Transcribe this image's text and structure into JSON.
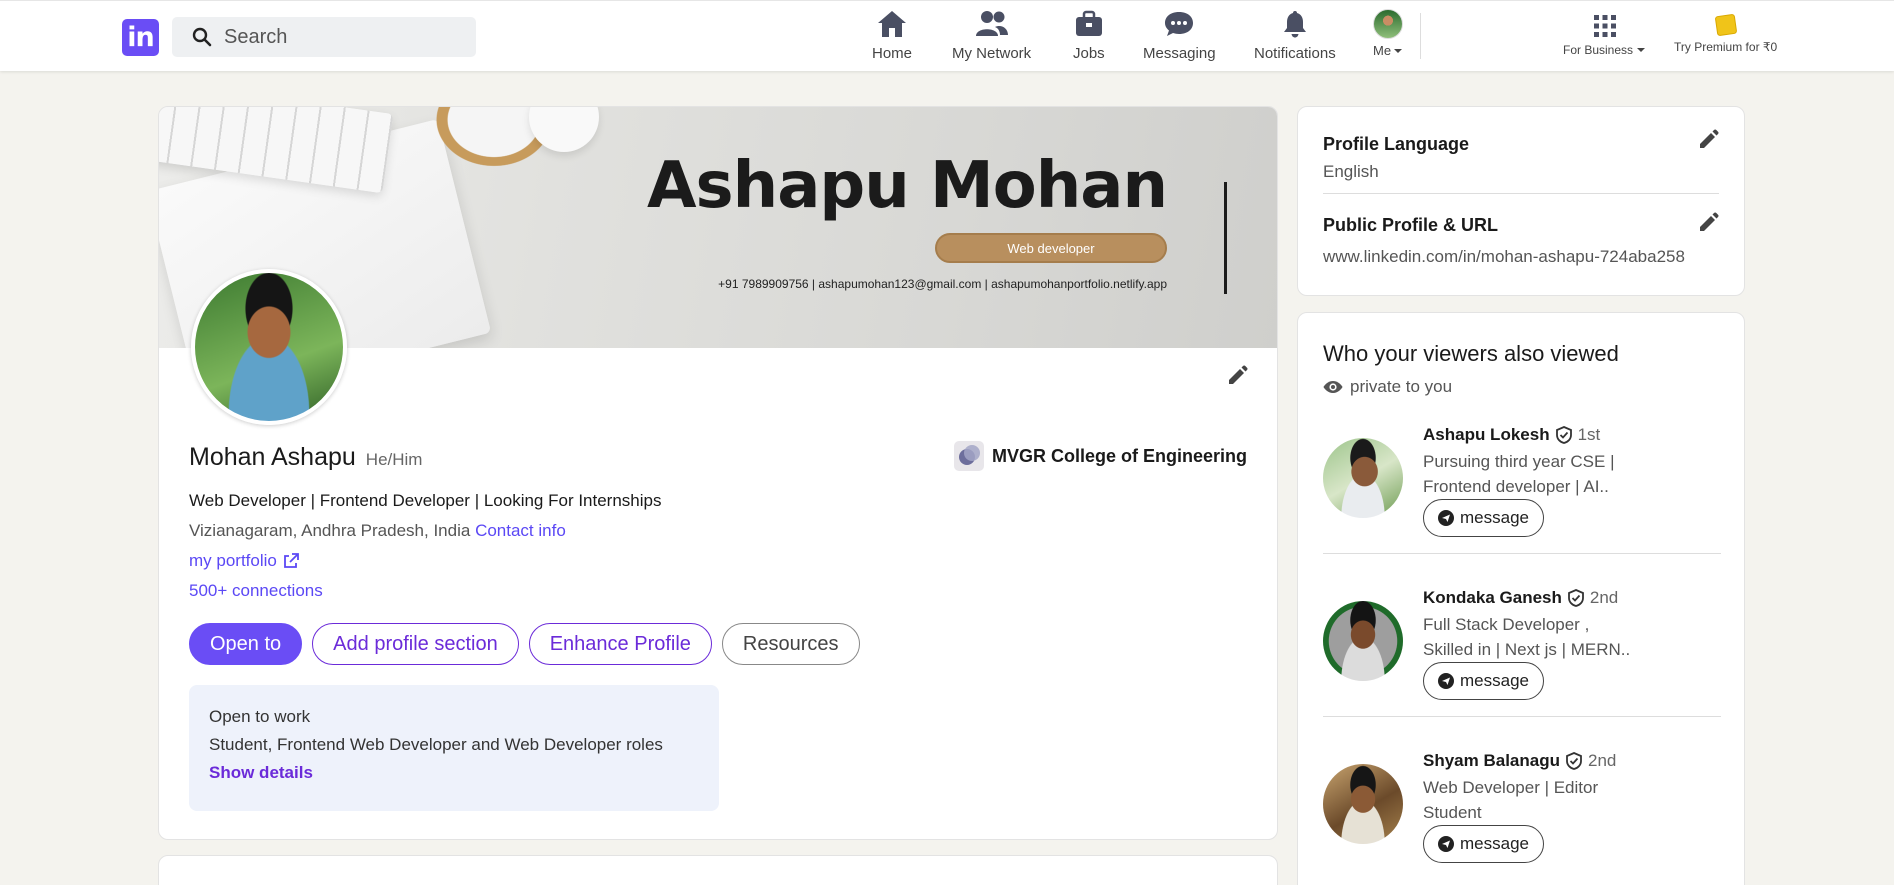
{
  "nav": {
    "logo_text": "in",
    "search_placeholder": "Search",
    "items": [
      {
        "label": "Home",
        "icon": "home-icon"
      },
      {
        "label": "My Network",
        "icon": "network-icon"
      },
      {
        "label": "Jobs",
        "icon": "briefcase-icon"
      },
      {
        "label": "Messaging",
        "icon": "chat-icon"
      },
      {
        "label": "Notifications",
        "icon": "bell-icon"
      }
    ],
    "me_label": "Me",
    "business_label": "For Business",
    "premium_label": "Try Premium for ₹0"
  },
  "banner": {
    "name": "Ashapu Mohan",
    "role": "Web developer",
    "contact": "+91 7989909756  |  ashapumohan123@gmail.com  |  ashapumohanportfolio.netlify.app"
  },
  "profile": {
    "name": "Mohan Ashapu",
    "pronouns": "He/Him",
    "college": "MVGR College of Engineering",
    "headline": "Web Developer | Frontend Developer | Looking For Internships",
    "location": "Vizianagaram, Andhra Pradesh, India",
    "contact_info_label": "Contact info",
    "portfolio_label": "my portfolio",
    "connections": "500+ connections",
    "buttons": {
      "open_to": "Open to",
      "add_section": "Add profile section",
      "enhance": "Enhance Profile",
      "resources": "Resources"
    },
    "open_to_work": {
      "title": "Open to work",
      "roles": "Student, Frontend Web Developer and Web Developer roles",
      "show_details": "Show details"
    }
  },
  "sidebar": {
    "language": {
      "title": "Profile Language",
      "value": "English"
    },
    "public_profile": {
      "title": "Public Profile & URL",
      "value": "www.linkedin.com/in/mohan-ashapu-724aba258"
    },
    "viewers": {
      "title": "Who your viewers also viewed",
      "subtitle": "private to you",
      "people": [
        {
          "name": "Ashapu Lokesh",
          "degree": "1st",
          "headline_1": "Pursuing third year CSE |",
          "headline_2": "Frontend developer | AI..",
          "button": "message"
        },
        {
          "name": "Kondaka Ganesh",
          "degree": "2nd",
          "headline_1": "Full Stack Developer ,",
          "headline_2": "Skilled in | Next js | MERN..",
          "button": "message"
        },
        {
          "name": "Shyam Balanagu",
          "degree": "2nd",
          "headline_1": "Web Developer | Editor",
          "headline_2": "Student",
          "button": "message"
        }
      ]
    }
  },
  "colors": {
    "brand": "#6a4df5",
    "accent_purple": "#6b2bd9",
    "banner_role": "#b88f5e",
    "open_to_work_bg": "#eef2fb"
  }
}
